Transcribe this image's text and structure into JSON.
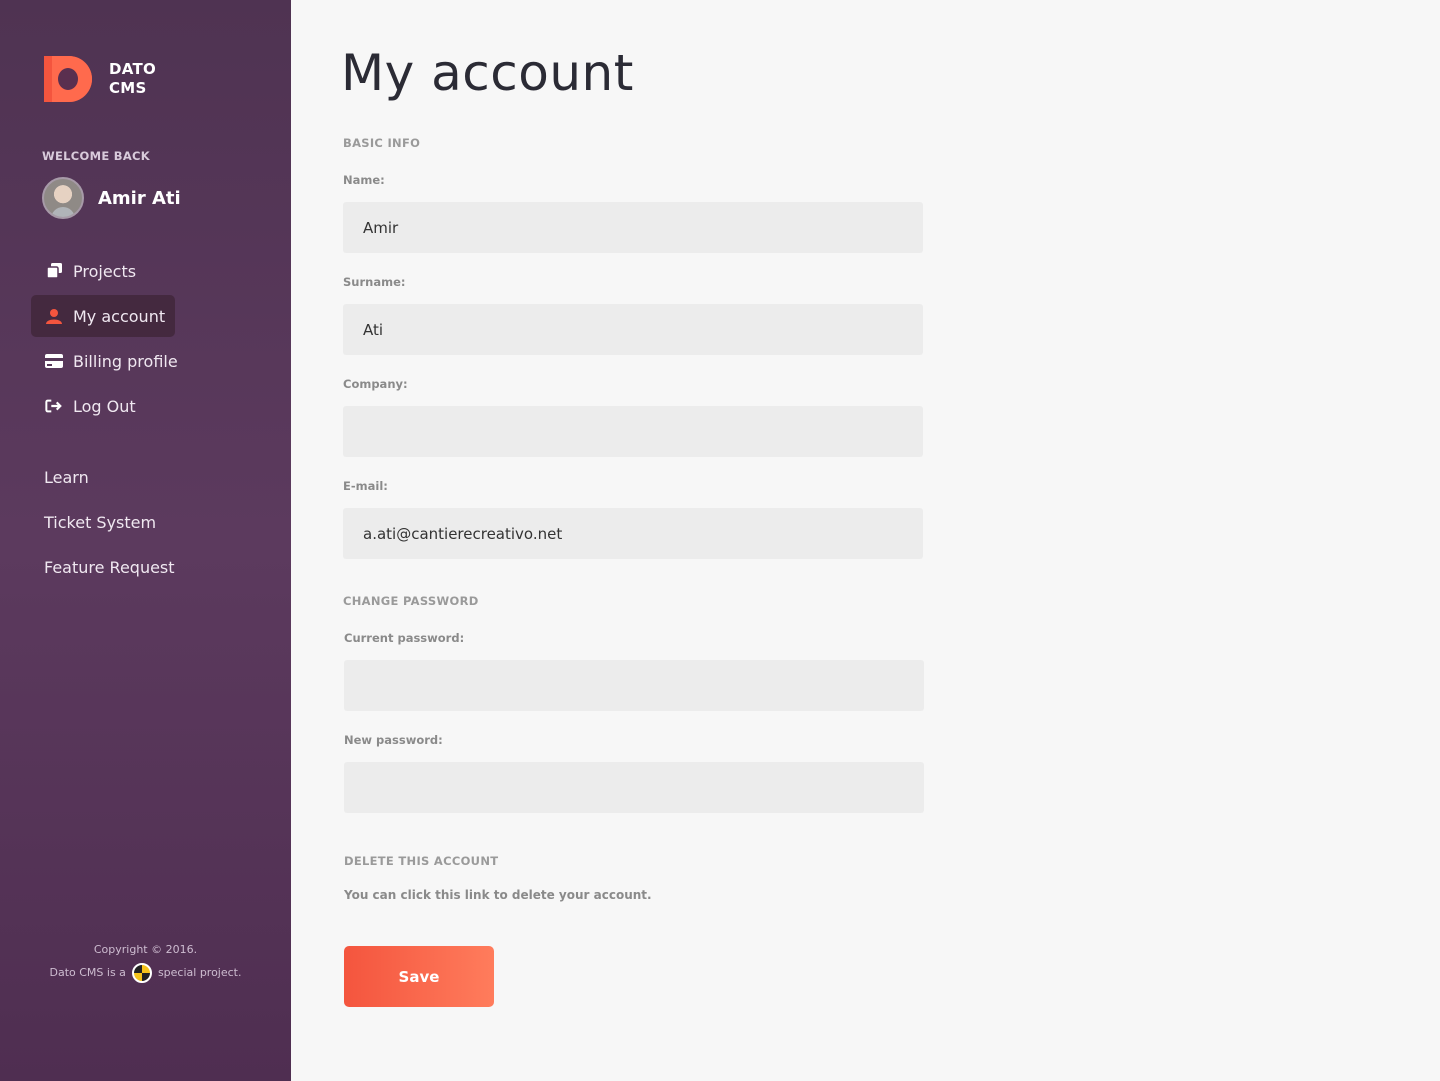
{
  "brand": {
    "line1": "DATO",
    "line2": "CMS",
    "accent": "#f4553e"
  },
  "sidebar": {
    "welcome_label": "WELCOME BACK",
    "user_name": "Amir Ati",
    "nav": [
      {
        "label": "Projects",
        "icon": "projects-icon"
      },
      {
        "label": "My account",
        "icon": "user-icon",
        "active": true
      },
      {
        "label": "Billing profile",
        "icon": "credit-card-icon"
      },
      {
        "label": "Log Out",
        "icon": "logout-icon"
      }
    ],
    "links": [
      "Learn",
      "Ticket System",
      "Feature Request"
    ],
    "footer": {
      "line1": "Copyright © 2016.",
      "line2_pre": "Dato CMS is a",
      "line2_post": "special project."
    }
  },
  "main": {
    "title": "My account",
    "basic_info": {
      "heading": "BASIC INFO",
      "name_label": "Name:",
      "name_value": "Amir",
      "surname_label": "Surname:",
      "surname_value": "Ati",
      "company_label": "Company:",
      "company_value": "",
      "email_label": "E-mail:",
      "email_value": "a.ati@cantierecreativo.net"
    },
    "change_password": {
      "heading": "CHANGE PASSWORD",
      "current_label": "Current password:",
      "new_label": "New password:"
    },
    "delete_account": {
      "heading": "DELETE THIS ACCOUNT",
      "help": "You can click this link to delete your account."
    },
    "save_label": "Save"
  }
}
